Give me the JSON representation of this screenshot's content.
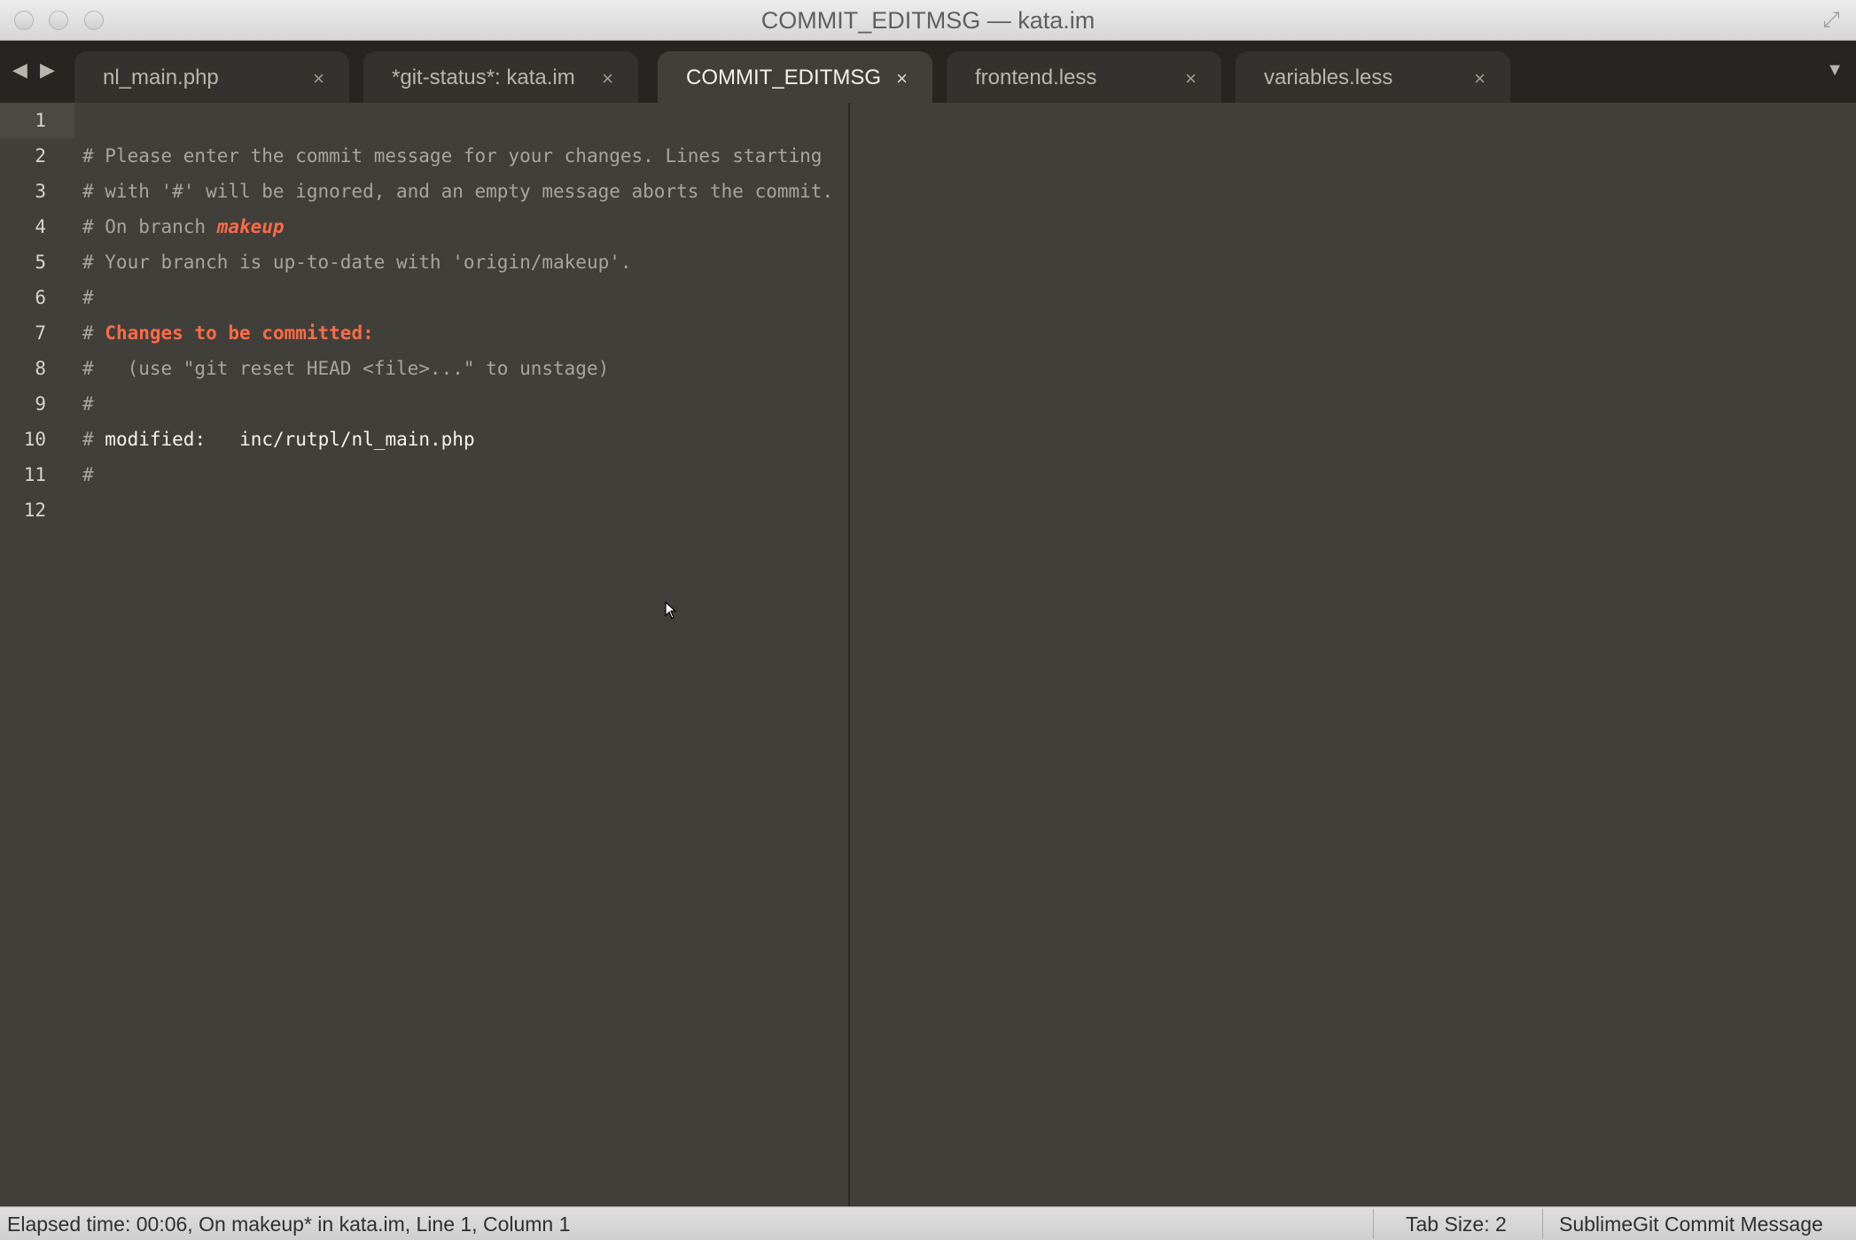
{
  "window": {
    "title": "COMMIT_EDITMSG — kata.im"
  },
  "tabs": [
    {
      "label": "nl_main.php",
      "close": "×",
      "active": false
    },
    {
      "label": "*git-status*: kata.im",
      "close": "×",
      "active": false
    },
    {
      "label": "COMMIT_EDITMSG",
      "close": "×",
      "active": true
    },
    {
      "label": "frontend.less",
      "close": "×",
      "active": false
    },
    {
      "label": "variables.less",
      "close": "×",
      "active": false
    }
  ],
  "nav": {
    "back_icon": "◀",
    "forward_icon": "▶",
    "tab_menu_icon": "▼"
  },
  "editor": {
    "lines": [
      {
        "no": "1",
        "text": ""
      },
      {
        "no": "2",
        "text": "# Please enter the commit message for your changes. Lines starting"
      },
      {
        "no": "3",
        "text": "# with '#' will be ignored, and an empty message aborts the commit."
      },
      {
        "no": "4",
        "prefix": "# On branch ",
        "branch": "makeup"
      },
      {
        "no": "5",
        "text": "# Your branch is up-to-date with 'origin/makeup'."
      },
      {
        "no": "6",
        "text": "#"
      },
      {
        "no": "7",
        "prefix": "# ",
        "heading": "Changes to be committed:"
      },
      {
        "no": "8",
        "text": "#   (use \"git reset HEAD <file>...\" to unstage)"
      },
      {
        "no": "9",
        "text": "#"
      },
      {
        "no": "10",
        "prefix": "# ",
        "label": "modified:",
        "file": "inc/rutpl/nl_main.php"
      },
      {
        "no": "11",
        "text": "#"
      },
      {
        "no": "12",
        "text": ""
      }
    ]
  },
  "statusbar": {
    "left": "Elapsed time: 00:06, On makeup* in kata.im, Line 1, Column 1",
    "tab_size": "Tab Size: 2",
    "syntax": "SublimeGit Commit Message"
  },
  "colors": {
    "background": "#403f3a",
    "tabbar": "#262521",
    "accent": "#ff6a46",
    "comment": "#a6a59e"
  }
}
